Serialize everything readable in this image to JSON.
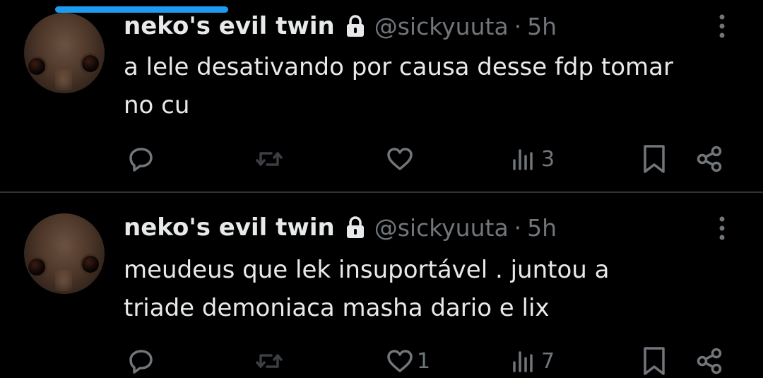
{
  "colors": {
    "background": "#000000",
    "text": "#e7e9ea",
    "muted": "#71767b",
    "accent": "#1d9bf0",
    "divider": "#2f3336"
  },
  "icons": [
    "lock-icon",
    "more-icon",
    "reply-icon",
    "retweet-icon",
    "like-icon",
    "views-icon",
    "bookmark-icon",
    "share-icon"
  ],
  "tweets": [
    {
      "author": {
        "name": "neko's evil twin",
        "handle": "@sickyuuta",
        "dot": "·",
        "time": "5h"
      },
      "lines": [
        "a lele desativando por causa desse fdp tomar",
        "no cu"
      ],
      "stats": {
        "replies": "",
        "retweets": "",
        "likes": "",
        "views": "3"
      }
    },
    {
      "author": {
        "name": "neko's evil twin",
        "handle": "@sickyuuta",
        "dot": "·",
        "time": "5h"
      },
      "lines": [
        "meudeus que lek insuportável . juntou a",
        "triade demoniaca masha dario e lix"
      ],
      "stats": {
        "replies": "",
        "retweets": "",
        "likes": "1",
        "views": "7"
      }
    }
  ]
}
